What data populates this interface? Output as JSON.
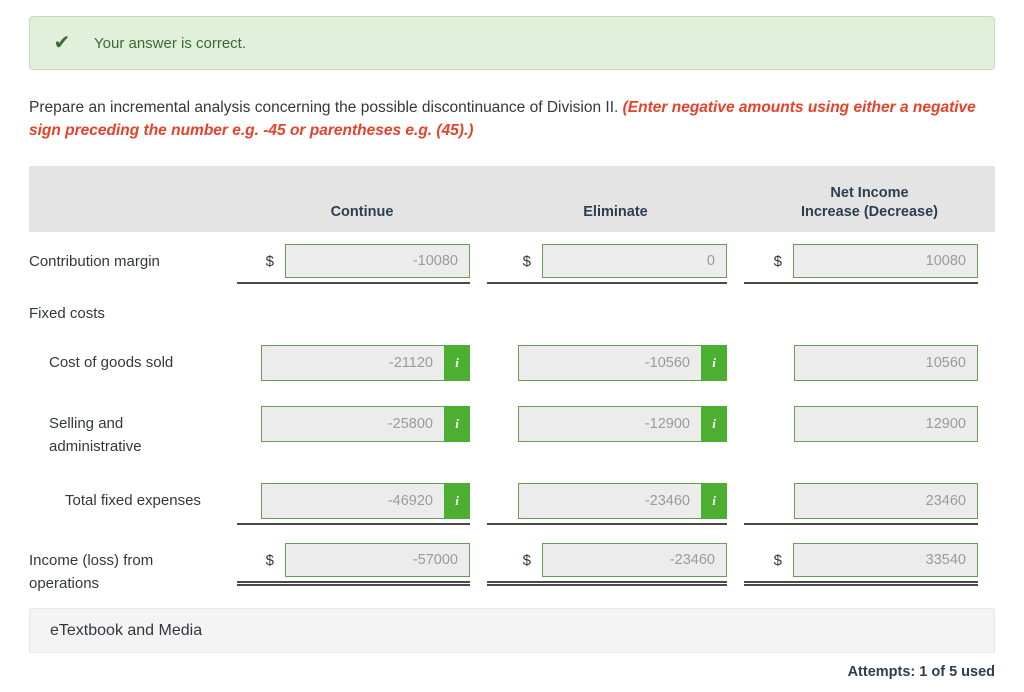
{
  "banner": {
    "icon": "check-icon",
    "text": "Your answer is correct."
  },
  "instruction": {
    "main": "Prepare an incremental analysis concerning the possible discontinuance of Division II. ",
    "hint": "(Enter negative amounts using either a negative sign preceding the number e.g. -45 or parentheses e.g. (45).)"
  },
  "table": {
    "headers": {
      "label": "",
      "col1": "Continue",
      "col2": "Eliminate",
      "col3_line1": "Net Income",
      "col3_line2": "Increase (Decrease)"
    },
    "rows": [
      {
        "label": "Contribution margin",
        "continue": "-10080",
        "eliminate": "0",
        "net": "10080"
      },
      {
        "label": "Fixed costs"
      },
      {
        "label": "Cost of goods sold",
        "continue": "-21120",
        "eliminate": "-10560",
        "net": "10560",
        "info_label": "i"
      },
      {
        "label": "Selling and administrative",
        "continue": "-25800",
        "eliminate": "-12900",
        "net": "12900",
        "info_label": "i"
      },
      {
        "label": "Total fixed expenses",
        "continue": "-46920",
        "eliminate": "-23460",
        "net": "23460",
        "info_label": "i"
      },
      {
        "label": "Income (loss) from operations",
        "continue": "-57000",
        "eliminate": "-23460",
        "net": "33540"
      }
    ],
    "currency_symbol": "$"
  },
  "etextbook": {
    "label": "eTextbook and Media"
  },
  "footer": {
    "attempts": "Attempts: 1 of 5 used"
  },
  "colors": {
    "success_bg": "#e2efda",
    "success_text": "#3a6b35",
    "hint_red": "#e8412a",
    "info_green": "#4caf32",
    "input_border": "#6a9a53",
    "header_bg": "#e4e4e4"
  }
}
